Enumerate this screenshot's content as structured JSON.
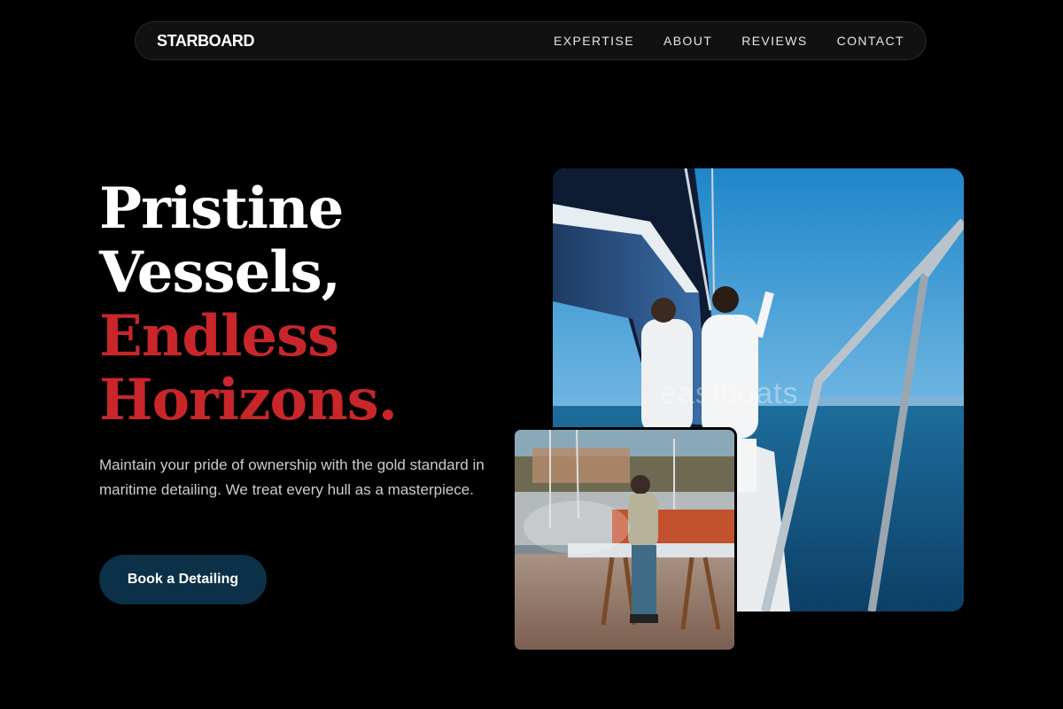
{
  "nav": {
    "brand": "STARBOARD",
    "links": [
      "EXPERTISE",
      "ABOUT",
      "REVIEWS",
      "CONTACT"
    ]
  },
  "hero": {
    "headline_line1": "Pristine",
    "headline_line2": "Vessels,",
    "headline_line3": "Endless",
    "headline_line4": "Horizons.",
    "description": "Maintain your pride of ownership with the gold standard in maritime detailing. We treat every hull as a masterpiece.",
    "cta_label": "Book a Detailing"
  },
  "images": {
    "main_watermark": "eastboats"
  },
  "colors": {
    "background": "#000000",
    "accent_red": "#c8262a",
    "cta_background": "#0b3048",
    "nav_background": "#111111"
  }
}
